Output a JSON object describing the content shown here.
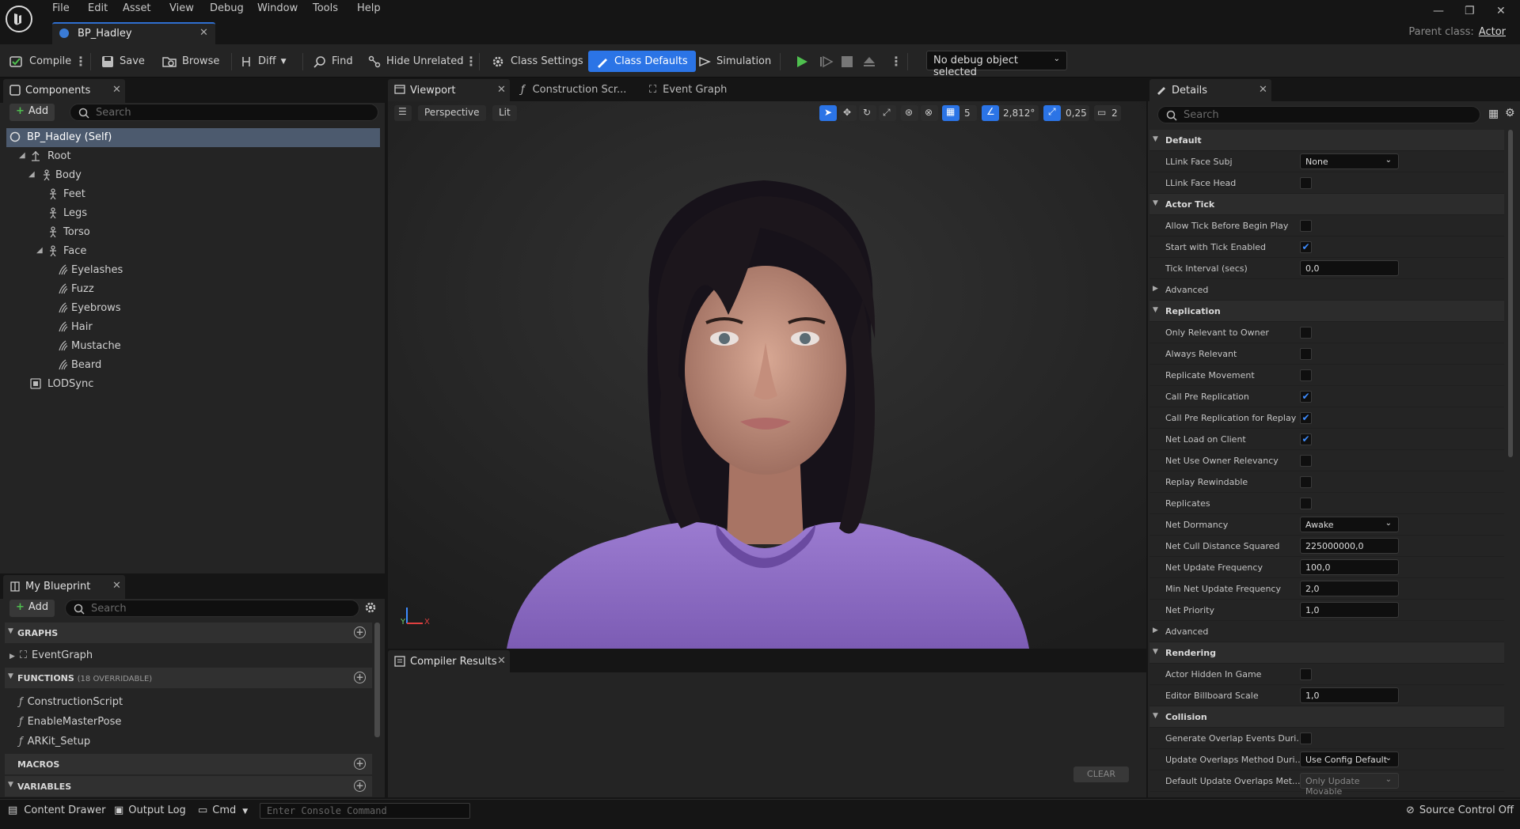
{
  "menu": [
    "File",
    "Edit",
    "Asset",
    "View",
    "Debug",
    "Window",
    "Tools",
    "Help"
  ],
  "doc_tab": "BP_Hadley",
  "parent_class": {
    "label": "Parent class:",
    "value": "Actor"
  },
  "toolbar": {
    "compile": "Compile",
    "save": "Save",
    "browse": "Browse",
    "diff": "Diff",
    "find": "Find",
    "hide_unrelated": "Hide Unrelated",
    "class_settings": "Class Settings",
    "class_defaults": "Class Defaults",
    "simulation": "Simulation",
    "debug_object": "No debug object selected"
  },
  "components": {
    "tab": "Components",
    "add": "Add",
    "search_placeholder": "Search",
    "items": [
      "BP_Hadley (Self)",
      "Root",
      "Body",
      "Feet",
      "Legs",
      "Torso",
      "Face",
      "Eyelashes",
      "Fuzz",
      "Eyebrows",
      "Hair",
      "Mustache",
      "Beard",
      "LODSync"
    ]
  },
  "my_blueprint": {
    "tab": "My Blueprint",
    "add": "Add",
    "search_placeholder": "Search",
    "graphs": "GRAPHS",
    "event_graph": "EventGraph",
    "functions": "FUNCTIONS",
    "functions_note": "(18 OVERRIDABLE)",
    "function_items": [
      "ConstructionScript",
      "EnableMasterPose",
      "ARKit_Setup"
    ],
    "macros": "MACROS",
    "variables": "VARIABLES"
  },
  "center_tabs": [
    "Viewport",
    "Construction Scr...",
    "Event Graph"
  ],
  "viewport": {
    "perspective": "Perspective",
    "lit": "Lit",
    "grid_value": "5",
    "angle_value": "2,812°",
    "scale_value": "0,25",
    "camera_value": "2",
    "axis_y": "Y",
    "axis_x": "X"
  },
  "compiler": {
    "tab": "Compiler Results",
    "clear": "CLEAR"
  },
  "details": {
    "tab": "Details",
    "search_placeholder": "Search",
    "rows": [
      {
        "type": "cat",
        "label": "Default"
      },
      {
        "type": "dd",
        "label": "LLink Face Subj",
        "value": "None"
      },
      {
        "type": "cb",
        "label": "LLink Face Head",
        "checked": false
      },
      {
        "type": "cat",
        "label": "Actor Tick"
      },
      {
        "type": "cb",
        "label": "Allow Tick Before Begin Play",
        "checked": false
      },
      {
        "type": "cb",
        "label": "Start with Tick Enabled",
        "checked": true
      },
      {
        "type": "num",
        "label": "Tick Interval (secs)",
        "value": "0,0"
      },
      {
        "type": "sub",
        "label": "Advanced"
      },
      {
        "type": "cat",
        "label": "Replication"
      },
      {
        "type": "cb",
        "label": "Only Relevant to Owner",
        "checked": false
      },
      {
        "type": "cb",
        "label": "Always Relevant",
        "checked": false
      },
      {
        "type": "cb",
        "label": "Replicate Movement",
        "checked": false
      },
      {
        "type": "cb",
        "label": "Call Pre Replication",
        "checked": true
      },
      {
        "type": "cb",
        "label": "Call Pre Replication for Replay",
        "checked": true
      },
      {
        "type": "cb",
        "label": "Net Load on Client",
        "checked": true
      },
      {
        "type": "cb",
        "label": "Net Use Owner Relevancy",
        "checked": false
      },
      {
        "type": "cb",
        "label": "Replay Rewindable",
        "checked": false
      },
      {
        "type": "cb",
        "label": "Replicates",
        "checked": false
      },
      {
        "type": "dd",
        "label": "Net Dormancy",
        "value": "Awake"
      },
      {
        "type": "num",
        "label": "Net Cull Distance Squared",
        "value": "225000000,0"
      },
      {
        "type": "num",
        "label": "Net Update Frequency",
        "value": "100,0"
      },
      {
        "type": "num",
        "label": "Min Net Update Frequency",
        "value": "2,0"
      },
      {
        "type": "num",
        "label": "Net Priority",
        "value": "1,0"
      },
      {
        "type": "sub",
        "label": "Advanced"
      },
      {
        "type": "cat",
        "label": "Rendering"
      },
      {
        "type": "cb",
        "label": "Actor Hidden In Game",
        "checked": false
      },
      {
        "type": "num",
        "label": "Editor Billboard Scale",
        "value": "1,0"
      },
      {
        "type": "cat",
        "label": "Collision"
      },
      {
        "type": "cb",
        "label": "Generate Overlap Events Duri...",
        "checked": false
      },
      {
        "type": "dd",
        "label": "Update Overlaps Method Duri...",
        "value": "Use Config Default"
      },
      {
        "type": "dd",
        "label": "Default Update Overlaps Met...",
        "value": "Only Update Movable",
        "disabled": true
      }
    ]
  },
  "statusbar": {
    "content_drawer": "Content Drawer",
    "output_log": "Output Log",
    "cmd": "Cmd",
    "console_placeholder": "Enter Console Command",
    "source_control": "Source Control Off"
  },
  "colors": {
    "accent": "#2b74e6",
    "sweater": "#8e6cc4",
    "hair": "#1a1516",
    "play_green": "#4fc04f"
  }
}
